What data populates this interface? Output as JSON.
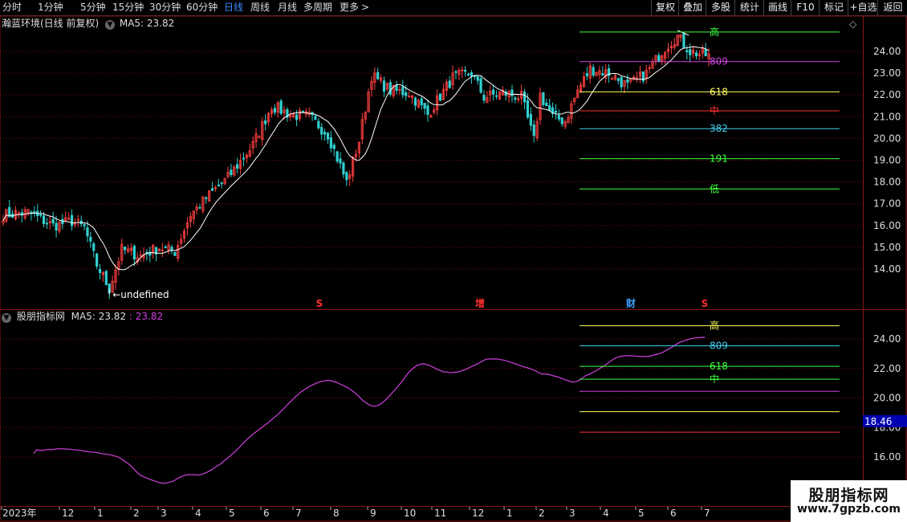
{
  "toolbar": {
    "periods": [
      {
        "label": "分时"
      },
      {
        "label": "1分钟"
      },
      {
        "label": "5分钟"
      },
      {
        "label": "15分钟"
      },
      {
        "label": "30分钟"
      },
      {
        "label": "60分钟"
      },
      {
        "label": "日线",
        "active": true
      },
      {
        "label": "周线"
      },
      {
        "label": "月线"
      },
      {
        "label": "多周期"
      },
      {
        "label": "更多"
      }
    ],
    "more_arrow": ">",
    "buttons": [
      {
        "label": "复权"
      },
      {
        "label": "叠加"
      },
      {
        "label": "多股"
      },
      {
        "label": "统计"
      },
      {
        "label": "画线"
      },
      {
        "label": "F10"
      },
      {
        "label": "标记"
      },
      {
        "label": "+自选"
      },
      {
        "label": "返回"
      }
    ]
  },
  "main_panel": {
    "title": "瀚蓝环境(日线 前复权)",
    "ma_label": "MA5: 23.82",
    "high_label": "24.89",
    "low_label": "12.87",
    "diamond": "◇"
  },
  "sub_panel": {
    "title": "股朋指标网",
    "ma_label": "MA5: 23.82",
    "ma_value": ": 23.82",
    "value_tag": "18.46"
  },
  "colors": {
    "up": "#ff4040",
    "down": "#30d0d0",
    "ma": "#ffffff",
    "grid": "#7a1010",
    "sub_line": "#d040e0",
    "axis_text": "#dddddd",
    "value_tag_bg": "#0000b0"
  },
  "chart_data": [
    {
      "type": "candlestick",
      "title": "瀚蓝环境(日线 前复权)",
      "ylim": [
        13.0,
        25.0
      ],
      "y_ticks": [
        "14.00",
        "15.00",
        "16.00",
        "17.00",
        "18.00",
        "19.00",
        "20.00",
        "21.00",
        "22.00",
        "23.00",
        "24.00"
      ],
      "x_ticks": [
        "2023年",
        "12",
        "1",
        "2",
        "3",
        "4",
        "5",
        "6",
        "7",
        "8",
        "9",
        "10",
        "11",
        "12",
        "1",
        "2",
        "3",
        "4",
        "5",
        "6",
        "7"
      ],
      "ma_series": {
        "name": "MA5",
        "last": 23.82
      },
      "price_anchors": [
        [
          0,
          16.5
        ],
        [
          8,
          16.6
        ],
        [
          16,
          16.0
        ],
        [
          22,
          16.2
        ],
        [
          26,
          15.9
        ],
        [
          30,
          14.2
        ],
        [
          34,
          13.1
        ],
        [
          38,
          14.9
        ],
        [
          44,
          14.6
        ],
        [
          50,
          15.0
        ],
        [
          55,
          14.8
        ],
        [
          60,
          16.5
        ],
        [
          66,
          17.4
        ],
        [
          72,
          18.2
        ],
        [
          80,
          19.7
        ],
        [
          86,
          21.5
        ],
        [
          92,
          21.1
        ],
        [
          98,
          21.0
        ],
        [
          104,
          20.2
        ],
        [
          110,
          18.0
        ],
        [
          114,
          19.9
        ],
        [
          118,
          22.9
        ],
        [
          124,
          22.2
        ],
        [
          130,
          22.1
        ],
        [
          136,
          21.1
        ],
        [
          144,
          22.8
        ],
        [
          150,
          23.0
        ],
        [
          154,
          21.9
        ],
        [
          160,
          22.1
        ],
        [
          166,
          21.9
        ],
        [
          170,
          19.9
        ],
        [
          172,
          22.0
        ],
        [
          176,
          21.0
        ],
        [
          180,
          20.8
        ],
        [
          184,
          22.2
        ],
        [
          188,
          23.2
        ],
        [
          194,
          23.0
        ],
        [
          200,
          22.4
        ],
        [
          206,
          23.0
        ],
        [
          212,
          24.2
        ],
        [
          216,
          24.7
        ],
        [
          220,
          24.0
        ],
        [
          226,
          23.8
        ]
      ],
      "fib_lines": [
        {
          "label": "高",
          "value": 24.89,
          "color": "#40ff40"
        },
        {
          "label": "809",
          "value": 23.53,
          "color": "#d040e0"
        },
        {
          "label": "618",
          "value": 22.14,
          "color": "#ffff60"
        },
        {
          "label": "中",
          "value": 21.27,
          "color": "#ff3030"
        },
        {
          "label": "382",
          "value": 20.45,
          "color": "#40d0f0"
        },
        {
          "label": "191",
          "value": 19.07,
          "color": "#40ff40"
        },
        {
          "label": "低",
          "value": 17.68,
          "color": "#40ff40"
        }
      ],
      "markers": [
        {
          "label": "S",
          "color": "#ff3030"
        },
        {
          "label": "增",
          "color": "#ff3030"
        },
        {
          "label": "财",
          "color": "#40a0ff"
        },
        {
          "label": "S",
          "color": "#ff3030"
        }
      ]
    },
    {
      "type": "line",
      "title": "股朋指标网",
      "ylim": [
        14.6,
        26.0
      ],
      "y_ticks": [
        "16.00",
        "18.00",
        "20.00",
        "22.00",
        "24.00"
      ],
      "series": [
        {
          "name": "MA5",
          "last": 23.82
        }
      ],
      "fib_lines": [
        {
          "label": "高",
          "value": 24.89,
          "color": "#ffff60"
        },
        {
          "label": "809",
          "value": 23.53,
          "color": "#40d0f0"
        },
        {
          "label": "618",
          "value": 22.14,
          "color": "#40ff40"
        },
        {
          "label": "中",
          "value": 21.27,
          "color": "#40ff40"
        },
        {
          "label": "",
          "value": 20.45,
          "color": "#d040e0"
        },
        {
          "label": "",
          "value": 19.07,
          "color": "#ffff60"
        },
        {
          "label": "",
          "value": 17.68,
          "color": "#ff3030"
        }
      ]
    }
  ],
  "watermark": {
    "line1": "股朋指标网",
    "line2": "www.7gpzb.com"
  }
}
